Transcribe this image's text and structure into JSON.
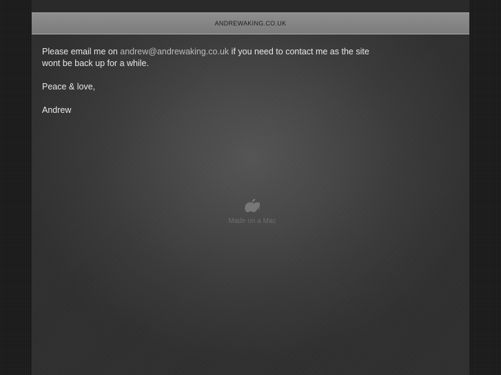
{
  "header": {
    "site_title": "ANDREWAKING.CO.UK"
  },
  "message": {
    "line1_before": "Please email me on ",
    "email": "andrew@andrewaking.co.uk",
    "line1_after": " if you need to contact me as the site",
    "line2": "wont be back up for a while.",
    "sign_off": "Peace & love,",
    "signature": "Andrew"
  },
  "badge": {
    "icon": "apple-logo-icon",
    "text": "Made on a Mac"
  },
  "colors": {
    "header_bg": "#858585",
    "text": "#e8e8e8",
    "link": "#bdbdbd",
    "background": "#1b1b1b"
  }
}
